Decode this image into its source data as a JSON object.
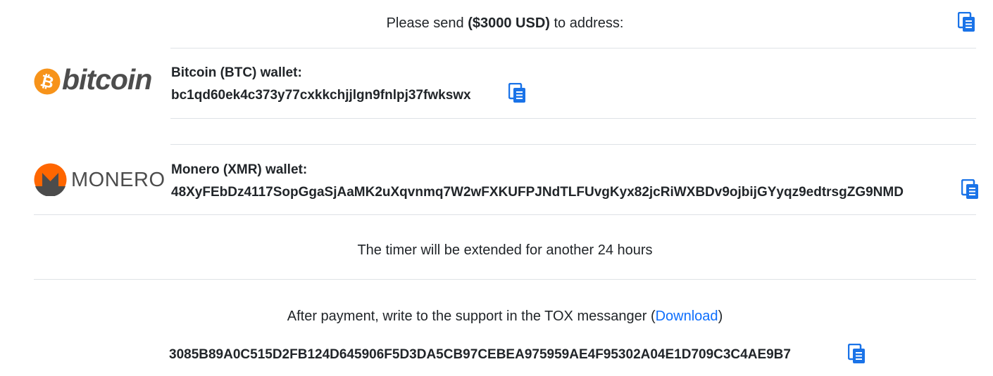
{
  "header": {
    "prefix": "Please send ",
    "amount": "($3000 USD)",
    "suffix": " to address:"
  },
  "bitcoin": {
    "logo_text": "bitcoin",
    "label": "Bitcoin (BTC) wallet:",
    "address": "bc1qd60ek4c373y77cxkkchjjlgn9fnlpj37fwkswx"
  },
  "monero": {
    "logo_text": "MONERO",
    "label": "Monero (XMR) wallet:",
    "address": "48XyFEbDz4117SopGgaSjAaMK2uXqvnmq7W2wFXKUFPJNdTLFUvgKyx82jcRiWXBDv9ojbijGYyqz9edtrsgZG9NMD"
  },
  "timer": {
    "text": "The timer will be extended for another 24 hours"
  },
  "support": {
    "text": "After payment, write to the support in the TOX messanger (",
    "link": "Download",
    "close": ")",
    "tox_id": "3085B89A0C515D2FB124D645906F5D3DA5CB97CEBEA975959AE4F95302A04E1D709C3C4AE9B7"
  },
  "icons": {
    "copy": "copy-icon",
    "bitcoin_logo": "bitcoin-logo-icon",
    "monero_logo": "monero-logo-icon"
  },
  "colors": {
    "copy_icon": "#1a73e8",
    "link": "#0d6efd",
    "bitcoin_orange": "#f7931a",
    "monero_orange": "#ff6600",
    "monero_grey": "#4c4c4c"
  }
}
